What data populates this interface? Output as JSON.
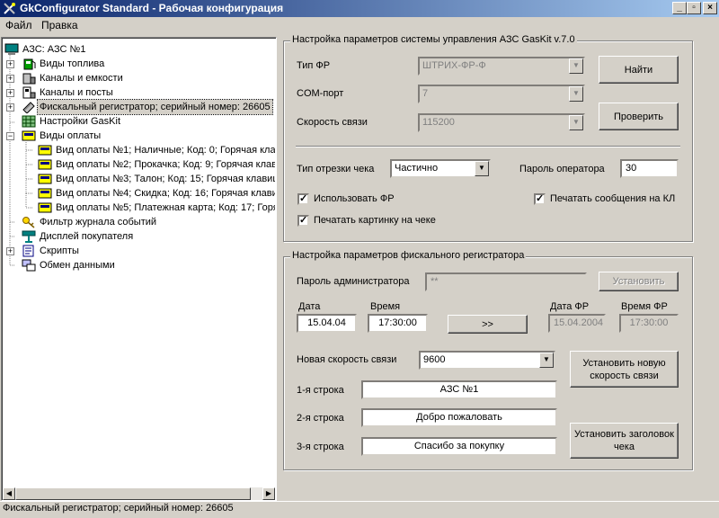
{
  "window": {
    "title": "GkConfigurator Standard - Рабочая конфигурация"
  },
  "menu": [
    "Файл",
    "Правка"
  ],
  "tree": {
    "root": "АЗС: АЗС №1",
    "items": [
      "Виды топлива",
      "Каналы и емкости",
      "Каналы и посты",
      "Фискальный регистратор; серийный номер: 26605",
      "Настройки GasKit",
      "Виды оплаты",
      "Вид оплаты №1; Наличные; Код: 0; Горячая клав",
      "Вид оплаты №2; Прокачка; Код: 9; Горячая клав",
      "Вид оплаты №3; Талон; Код: 15; Горячая клавиш",
      "Вид оплаты №4; Скидка; Код: 16; Горячая клави",
      "Вид оплаты №5; Платежная карта; Код: 17; Горя",
      "Фильтр журнала событий",
      "Дисплей покупателя",
      "Скрипты",
      "Обмен данными"
    ]
  },
  "system": {
    "title": "Настройка параметров системы управления АЗС GasKit v.7.0",
    "fr_type_label": "Тип ФР",
    "fr_type_value": "ШТРИХ-ФР-Ф",
    "com_label": "COM-порт",
    "com_value": "7",
    "speed_label": "Скорость связи",
    "speed_value": "115200",
    "find_button": "Найти",
    "check_button": "Проверить",
    "cut_label": "Тип отрезки чека",
    "cut_value": "Частично",
    "op_pass_label": "Пароль оператора",
    "op_pass_value": "30",
    "use_fr_label": "Использовать ФР",
    "print_msgs_label": "Печатать сообщения на КЛ",
    "print_pic_label": "Печатать картинку на чеке",
    "use_fr_checked": true,
    "print_msgs_checked": true,
    "print_pic_checked": true
  },
  "fiscal": {
    "title": "Настройка параметров фискального регистратора",
    "admin_pass_label": "Пароль администратора",
    "admin_pass_value": "**",
    "set_button": "Установить",
    "date_label": "Дата",
    "date_value": "15.04.04",
    "time_label": "Время",
    "time_value": "17:30:00",
    "sync_button": ">>",
    "fr_date_label": "Дата ФР",
    "fr_date_value": "15.04.2004",
    "fr_time_label": "Время ФР",
    "fr_time_value": "17:30:00",
    "new_speed_label": "Новая скорость связи",
    "new_speed_value": "9600",
    "set_speed_button": "Установить новую скорость связи",
    "line1_label": "1-я строка",
    "line1_value": "АЗС №1",
    "line2_label": "2-я строка",
    "line2_value": "Добро пожаловать",
    "line3_label": "3-я строка",
    "line3_value": "Спасибо за покупку",
    "set_header_button": "Установить заголовок чека"
  },
  "status": {
    "text": "Фискальный регистратор; серийный номер: 26605"
  },
  "colors": {
    "titlebar": "#0a246a",
    "face": "#d4d0c8"
  },
  "icons": [
    "fuel-icon",
    "tank-icon",
    "channel-icon",
    "register-icon",
    "grid-icon",
    "payment-icon",
    "key-icon",
    "display-icon",
    "script-icon",
    "exchange-icon"
  ]
}
